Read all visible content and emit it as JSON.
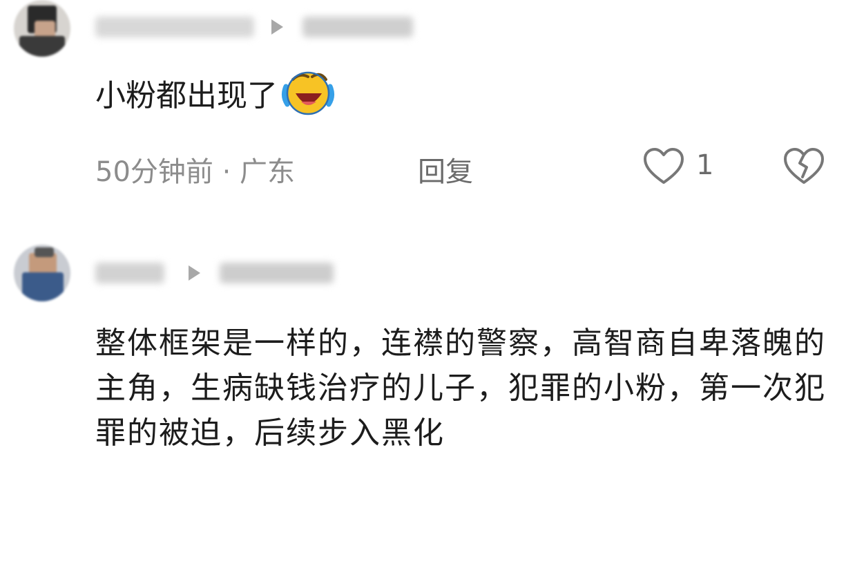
{
  "comments": [
    {
      "text": "小粉都出现了",
      "emoji": "laughing-crying-emoji",
      "time_location": "50分钟前 · 广东",
      "reply_label": "回复",
      "like_count": "1"
    },
    {
      "text": "整体框架是一样的，连襟的警察，高智商自卑落魄的主角，生病缺钱治疗的儿子，犯罪的小粉，第一次犯罪的被迫，后续步入黑化"
    }
  ],
  "icons": {
    "play": "play-triangle-icon",
    "like": "heart-outline-icon",
    "dislike": "broken-heart-icon"
  },
  "colors": {
    "text_primary": "#1c1c1c",
    "text_meta": "#8c8c8c",
    "icon_gray": "#777777"
  }
}
